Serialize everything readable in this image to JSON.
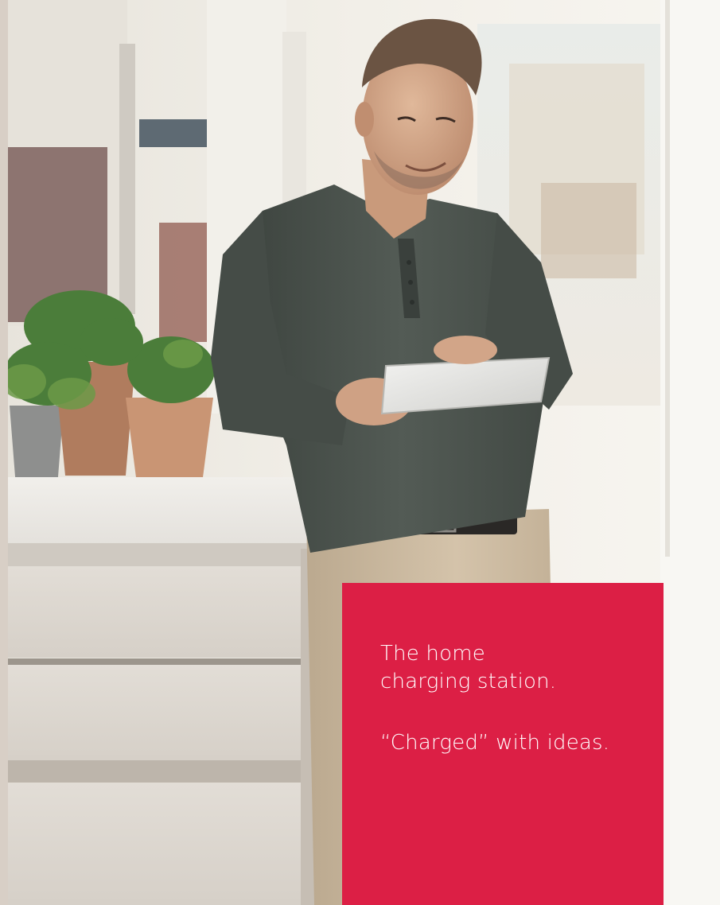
{
  "promo": {
    "heading_line1": "The home",
    "heading_line2": "charging station.",
    "tagline": "“Charged” with ideas."
  },
  "colors": {
    "panel_red": "#dc1f45",
    "text_white": "#ffffff",
    "wall_light": "#f4f1ec",
    "shirt_green": "#4c544f",
    "trousers_beige": "#cdbba2"
  },
  "image": {
    "subject": "man in kitchen using a tablet"
  }
}
